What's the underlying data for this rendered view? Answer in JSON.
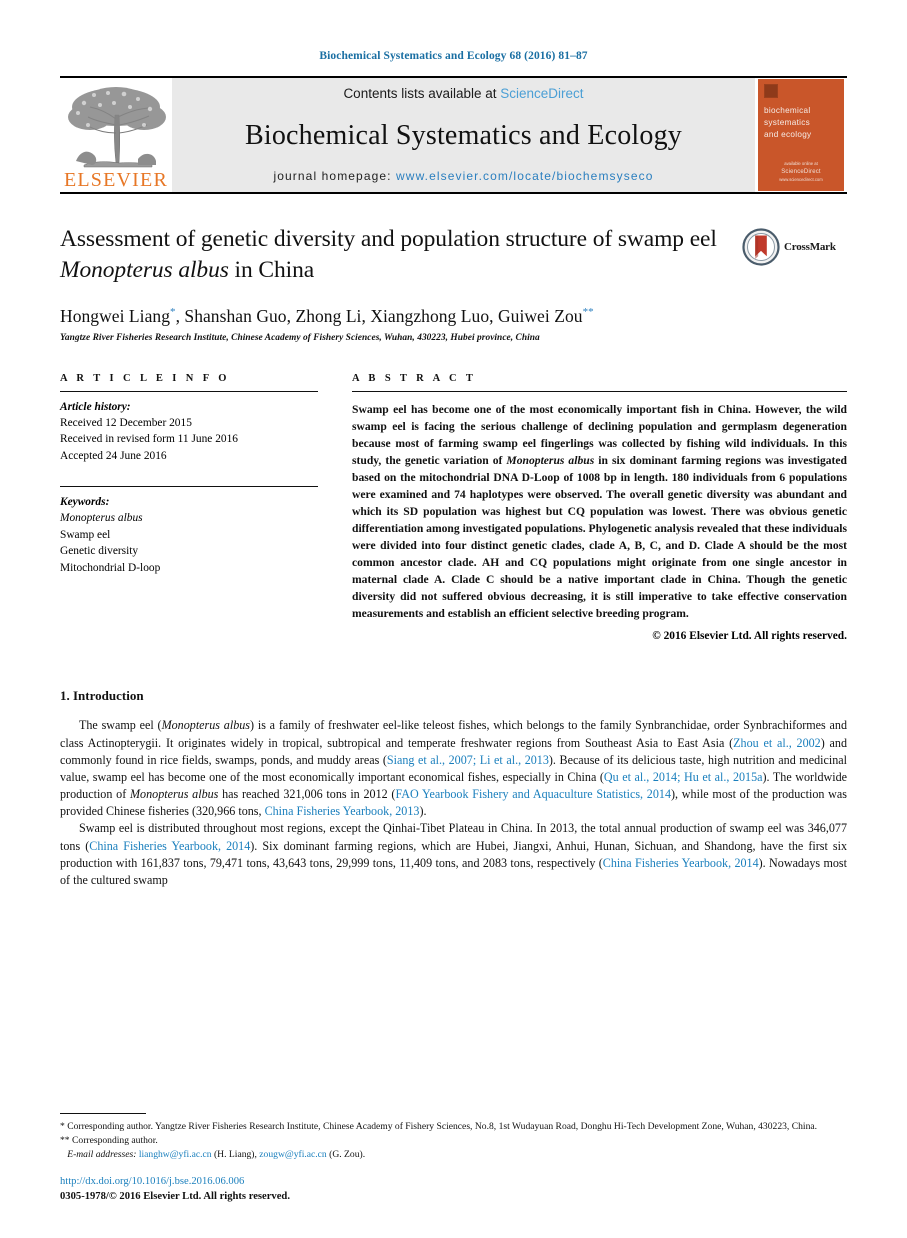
{
  "running_head": "Biochemical Systematics and Ecology 68 (2016) 81–87",
  "masthead": {
    "publisher_name": "ELSEVIER",
    "contents_prefix": "Contents lists available at ",
    "contents_link": "ScienceDirect",
    "journal_title": "Biochemical Systematics and Ecology",
    "homepage_label": "journal homepage: ",
    "homepage_url": "www.elsevier.com/locate/biochemsyseco",
    "cover": {
      "line1": "biochemical",
      "line2": "systematics",
      "line3": "and ecology",
      "foot_top": "available online at",
      "foot_logo": "ScienceDirect",
      "foot_bottom": "www.sciencedirect.com"
    },
    "colors": {
      "link_blue": "#4b9fd5",
      "elsevier_orange": "#e77726",
      "cover_orange": "#c9562a",
      "band_gray": "#e9e9e9"
    }
  },
  "article": {
    "title_part1": "Assessment of genetic diversity and population structure of swamp eel ",
    "title_italic": "Monopterus albus",
    "title_part2": " in China",
    "crossmark_label": "CrossMark",
    "authors": "Hongwei Liang, Shanshan Guo, Zhong Li, Xiangzhong Luo, Guiwei Zou",
    "author_mark_1": "*",
    "author_mark_2": "**",
    "affiliation": "Yangtze River Fisheries Research Institute, Chinese Academy of Fishery Sciences, Wuhan, 430223, Hubei province, China"
  },
  "article_info": {
    "heading": "A R T I C L E   I N F O",
    "history_label": "Article history:",
    "history": [
      "Received 12 December 2015",
      "Received in revised form 11 June 2016",
      "Accepted 24 June 2016"
    ],
    "keywords_label": "Keywords:",
    "keywords_italic": "Monopterus albus",
    "keywords": [
      "Swamp eel",
      "Genetic diversity",
      "Mitochondrial D-loop"
    ]
  },
  "abstract": {
    "heading": "A B S T R A C T",
    "p1": "Swamp eel has become one of the most economically important fish in China. However, the wild swamp eel is facing the serious challenge of declining population and germplasm degeneration because most of farming swamp eel fingerlings was collected by fishing wild individuals. In this study, the genetic variation of ",
    "species": "Monopterus albus",
    "p2": " in six dominant farming regions was investigated based on the mitochondrial DNA D-Loop of 1008 bp in length. 180 individuals from 6 populations were examined and 74 haplotypes were observed. The overall genetic diversity was abundant and which its SD population was highest but CQ population was lowest. There was obvious genetic differentiation among investigated populations. Phylogenetic analysis revealed that these individuals were divided into four distinct genetic clades, clade A, B, C, and D. Clade A should be the most common ancestor clade. AH and CQ populations might originate from one single ancestor in maternal clade A. Clade C should be a native important clade in China. Though the genetic diversity did not suffered obvious decreasing, it is still imperative to take effective conservation measurements and establish an efficient selective breeding program.",
    "copyright": "© 2016 Elsevier Ltd. All rights reserved."
  },
  "introduction": {
    "heading": "1. Introduction",
    "para1": {
      "s1": "The swamp eel (",
      "sp1": "Monopterus albus",
      "s2": ") is a family of freshwater eel-like teleost fishes, which belongs to the family Synbranchidae, order Synbrachiformes and class Actinopterygii. It originates widely in tropical, subtropical and temperate freshwater regions from Southeast Asia to East Asia (",
      "c1": "Zhou et al., 2002",
      "s3": ") and commonly found in rice fields, swamps, ponds, and muddy areas (",
      "c2": "Siang et al., 2007; Li et al., 2013",
      "s4": "). Because of its delicious taste, high nutrition and medicinal value, swamp eel has become one of the most economically important economical fishes, especially in China (",
      "c3": "Qu et al., 2014; Hu et al., 2015a",
      "s5": "). The worldwide production of ",
      "sp2": "Monopterus albus",
      "s6": " has reached 321,006 tons in 2012 (",
      "c4": "FAO Yearbook Fishery and Aquaculture Statistics, 2014",
      "s7": "), while most of the production was provided Chinese fisheries (320,966 tons, ",
      "c5": "China Fisheries Yearbook, 2013",
      "s8": ")."
    },
    "para2": {
      "s1": "Swamp eel is distributed throughout most regions, except the Qinhai-Tibet Plateau in China. In 2013, the total annual production of swamp eel was 346,077 tons (",
      "c1": "China Fisheries Yearbook, 2014",
      "s2": "). Six dominant farming regions, which are Hubei, Jiangxi, Anhui, Hunan, Sichuan, and Shandong, have the first six production with 161,837 tons, 79,471 tons, 43,643 tons, 29,999 tons, 11,409 tons, and 2083 tons, respectively (",
      "c2": "China Fisheries Yearbook, 2014",
      "s3": "). Nowadays most of the cultured swamp"
    }
  },
  "footnotes": {
    "fn1_mark": "*",
    "fn1": " Corresponding author. Yangtze River Fisheries Research Institute, Chinese Academy of Fishery Sciences, No.8, 1st Wudayuan Road, Donghu Hi-Tech Development Zone, Wuhan, 430223, China.",
    "fn2_mark": "**",
    "fn2": " Corresponding author.",
    "email_label": "E-mail addresses:",
    "email1": "lianghw@yfi.ac.cn",
    "email1_name": " (H. Liang), ",
    "email2": "zougw@yfi.ac.cn",
    "email2_name": " (G. Zou)."
  },
  "colophon": {
    "doi": "http://dx.doi.org/10.1016/j.bse.2016.06.006",
    "issn": "0305-1978/© 2016 Elsevier Ltd. All rights reserved."
  }
}
